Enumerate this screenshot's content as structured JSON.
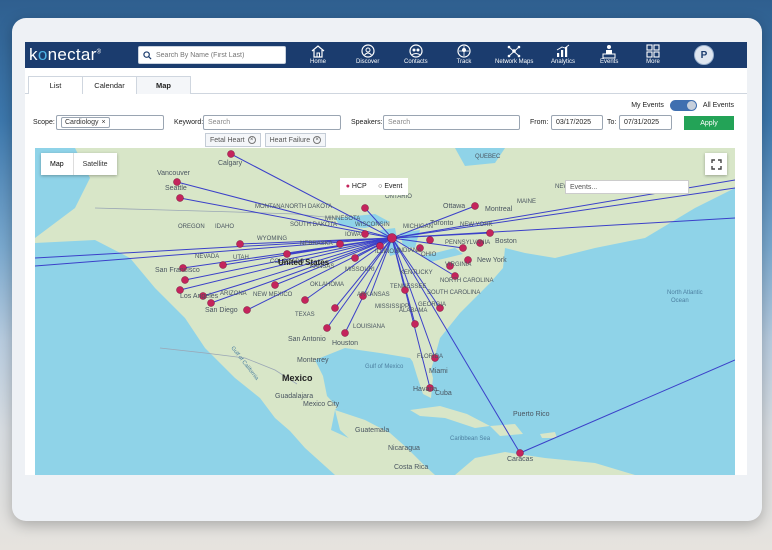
{
  "brand": {
    "name_pre": "k",
    "name_o": "o",
    "name_post": "nectar",
    "mark": "®"
  },
  "search": {
    "placeholder": "Search By Name (First Last)"
  },
  "nav": [
    {
      "label": "Home",
      "icon": "home-icon"
    },
    {
      "label": "Discover",
      "icon": "discover-icon"
    },
    {
      "label": "Contacts",
      "icon": "contacts-icon"
    },
    {
      "label": "Track",
      "icon": "track-icon"
    },
    {
      "label": "Network Maps",
      "icon": "network-icon"
    },
    {
      "label": "Analytics",
      "icon": "analytics-icon"
    },
    {
      "label": "Events",
      "icon": "events-icon"
    },
    {
      "label": "More",
      "icon": "grid-icon"
    }
  ],
  "avatar": "P",
  "tabs": [
    {
      "label": "List"
    },
    {
      "label": "Calendar"
    },
    {
      "label": "Map",
      "active": true
    }
  ],
  "toggle": {
    "left_label": "My Events",
    "right_label": "All Events",
    "selected": "All Events"
  },
  "filters": {
    "scope_label": "Scope:",
    "scope_chip": "Cardiology",
    "keyword_label": "Keyword:",
    "keyword_placeholder": "Search",
    "keyword_chips": [
      "Fetal Heart",
      "Heart Failure"
    ],
    "speakers_label": "Speakers:",
    "speakers_placeholder": "Search",
    "from_label": "From:",
    "from_value": "03/17/2025",
    "to_label": "To:",
    "to_value": "07/31/2025",
    "apply_label": "Apply"
  },
  "map": {
    "type_buttons": [
      "Map",
      "Satellite"
    ],
    "legend": {
      "hcp": "HCP",
      "event": "Event"
    },
    "events_placeholder": "Events...",
    "labels": {
      "calgary": "Calgary",
      "vancouver": "Vancouver",
      "seattle": "Seattle",
      "oregon": "OREGON",
      "idaho": "IDAHO",
      "montana": "MONTANA",
      "wyoming": "WYOMING",
      "nevada": "NEVADA",
      "utah": "UTAH",
      "colorado": "COLORADO",
      "arizona": "ARIZONA",
      "new_mexico": "NEW MEXICO",
      "north_dakota": "NORTH DAKOTA",
      "south_dakota": "SOUTH DAKOTA",
      "nebraska": "NEBRASKA",
      "kansas": "KANSAS",
      "oklahoma": "OKLAHOMA",
      "texas": "TEXAS",
      "minnesota": "MINNESOTA",
      "wisconsin": "WISCONSIN",
      "iowa": "IOWA",
      "missouri": "MISSOURI",
      "arkansas": "ARKANSAS",
      "louisiana": "LOUISIANA",
      "mississippi": "MISSISSIPPI",
      "alabama": "ALABAMA",
      "georgia": "GEORGIA",
      "tennessee": "TENNESSEE",
      "kentucky": "KENTUCKY",
      "ohio": "OHIO",
      "indiana": "INDIANA",
      "illinois": "ILLINOIS",
      "michigan": "MICHIGAN",
      "pennsylvania": "PENNSYLVANIA",
      "new_york": "NEW YORK",
      "virginia": "VIRGINIA",
      "north_carolina": "NORTH CAROLINA",
      "south_carolina": "SOUTH CAROLINA",
      "florida": "FLORIDA",
      "maine": "MAINE",
      "ontario": "ONTARIO",
      "quebec": "QUEBEC",
      "ottawa": "Ottawa",
      "montreal": "Montreal",
      "toronto": "Toronto",
      "boston": "Boston",
      "new_york_city": "New York",
      "united_states": "United States",
      "san_francisco": "San Francisco",
      "los_angeles": "Los Angeles",
      "san_diego": "San Diego",
      "houston": "Houston",
      "san_antonio": "San Antonio",
      "monterrey": "Monterrey",
      "mexico": "Mexico",
      "guadalajara": "Guadalajara",
      "mexico_city": "Mexico City",
      "gulf_of_mexico": "Gulf of Mexico",
      "miami": "Miami",
      "havana": "Havana",
      "cuba": "Cuba",
      "puerto_rico": "Puerto Rico",
      "guatemala": "Guatemala",
      "nicaragua": "Nicaragua",
      "costa_rica": "Costa Rica",
      "caribbean_sea": "Caribbean Sea",
      "caracas": "Caracas",
      "north_atlantic": "North Atlantic",
      "ocean": "Ocean",
      "gulf_of_california": "Gulf of California",
      "new_brunswick": "NEW BRUNSWICK"
    }
  }
}
